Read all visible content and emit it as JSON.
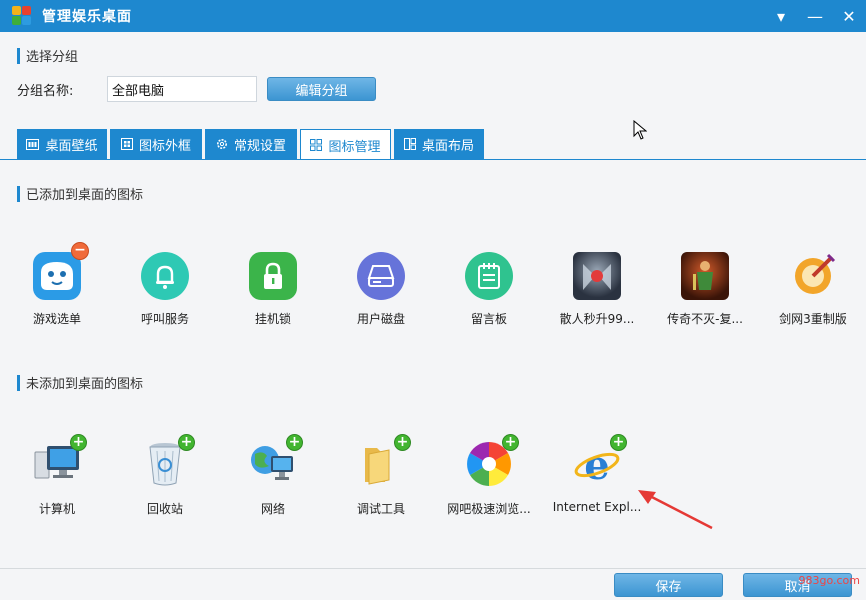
{
  "window": {
    "title": "管理娱乐桌面"
  },
  "group_section": {
    "title": "选择分组",
    "label": "分组名称:",
    "value": "全部电脑",
    "edit_button": "编辑分组"
  },
  "tabs": [
    {
      "label": "桌面壁纸",
      "icon": "wallpaper-icon",
      "active": false
    },
    {
      "label": "图标外框",
      "icon": "icon-frame-icon",
      "active": false
    },
    {
      "label": "常规设置",
      "icon": "gear-icon",
      "active": false
    },
    {
      "label": "图标管理",
      "icon": "grid-icon",
      "active": true
    },
    {
      "label": "桌面布局",
      "icon": "layout-icon",
      "active": false
    }
  ],
  "added_section": {
    "title": "已添加到桌面的图标",
    "items": [
      {
        "label": "游戏选单",
        "icon": "whale-game-icon"
      },
      {
        "label": "呼叫服务",
        "icon": "bell-icon"
      },
      {
        "label": "挂机锁",
        "icon": "lock-icon"
      },
      {
        "label": "用户磁盘",
        "icon": "disk-icon"
      },
      {
        "label": "留言板",
        "icon": "notepad-icon"
      },
      {
        "label": "散人秒升99...",
        "icon": "game-warrior-icon"
      },
      {
        "label": "传奇不灭-复...",
        "icon": "game-legend-icon"
      },
      {
        "label": "剑网3重制版",
        "icon": "game-jx3-icon"
      }
    ]
  },
  "not_added_section": {
    "title": "未添加到桌面的图标",
    "items": [
      {
        "label": "计算机",
        "icon": "computer-icon"
      },
      {
        "label": "回收站",
        "icon": "recycle-bin-icon"
      },
      {
        "label": "网络",
        "icon": "network-icon"
      },
      {
        "label": "调试工具",
        "icon": "folder-icon"
      },
      {
        "label": "网吧极速浏览...",
        "icon": "browser-icon"
      },
      {
        "label": "Internet Expl...",
        "icon": "ie-icon"
      }
    ]
  },
  "footer": {
    "save": "保存",
    "cancel": "取消"
  },
  "watermark": "983go.com",
  "colors": {
    "accent": "#1e88cf",
    "add": "#42b530",
    "remove": "#f06a3a"
  }
}
